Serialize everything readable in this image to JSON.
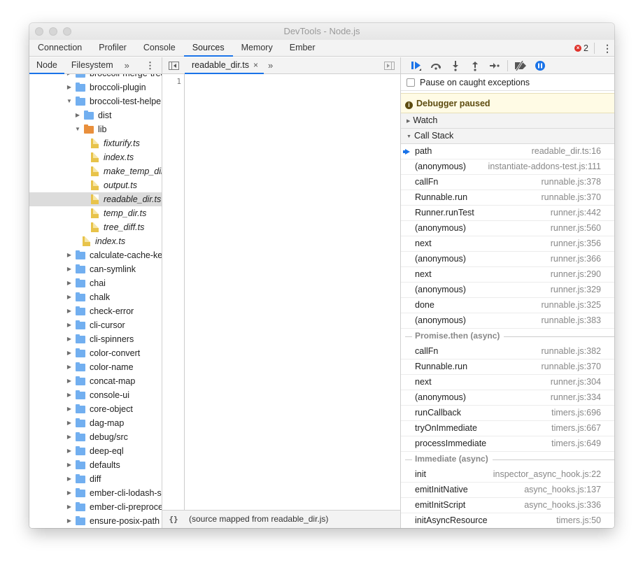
{
  "window": {
    "title": "DevTools - Node.js"
  },
  "main_tabs": [
    {
      "label": "Connection",
      "active": false
    },
    {
      "label": "Profiler",
      "active": false
    },
    {
      "label": "Console",
      "active": false
    },
    {
      "label": "Sources",
      "active": true
    },
    {
      "label": "Memory",
      "active": false
    },
    {
      "label": "Ember",
      "active": false
    }
  ],
  "errors": {
    "count": "2",
    "icon": "error-circle-icon"
  },
  "navigator": {
    "tabs": [
      {
        "label": "Node",
        "active": true
      },
      {
        "label": "Filesystem",
        "active": false
      }
    ],
    "more": "»",
    "tree": [
      {
        "label": "broccoli-merge-trees",
        "type": "folder",
        "depth": 0,
        "expanded": false
      },
      {
        "label": "broccoli-plugin",
        "type": "folder",
        "depth": 0,
        "expanded": false
      },
      {
        "label": "broccoli-test-helper",
        "type": "folder",
        "depth": 0,
        "expanded": true
      },
      {
        "label": "dist",
        "type": "folder",
        "depth": 1,
        "expanded": false
      },
      {
        "label": "lib",
        "type": "folder-orange",
        "depth": 1,
        "expanded": true
      },
      {
        "label": "fixturify.ts",
        "type": "file",
        "depth": 2
      },
      {
        "label": "index.ts",
        "type": "file",
        "depth": 2
      },
      {
        "label": "make_temp_dir.ts",
        "type": "file",
        "depth": 2
      },
      {
        "label": "output.ts",
        "type": "file",
        "depth": 2
      },
      {
        "label": "readable_dir.ts",
        "type": "file",
        "depth": 2,
        "selected": true
      },
      {
        "label": "temp_dir.ts",
        "type": "file",
        "depth": 2
      },
      {
        "label": "tree_diff.ts",
        "type": "file",
        "depth": 2
      },
      {
        "label": "index.ts",
        "type": "file",
        "depth": 1
      },
      {
        "label": "calculate-cache-key",
        "type": "folder",
        "depth": 0,
        "expanded": false
      },
      {
        "label": "can-symlink",
        "type": "folder",
        "depth": 0,
        "expanded": false
      },
      {
        "label": "chai",
        "type": "folder",
        "depth": 0,
        "expanded": false
      },
      {
        "label": "chalk",
        "type": "folder",
        "depth": 0,
        "expanded": false
      },
      {
        "label": "check-error",
        "type": "folder",
        "depth": 0,
        "expanded": false
      },
      {
        "label": "cli-cursor",
        "type": "folder",
        "depth": 0,
        "expanded": false
      },
      {
        "label": "cli-spinners",
        "type": "folder",
        "depth": 0,
        "expanded": false
      },
      {
        "label": "color-convert",
        "type": "folder",
        "depth": 0,
        "expanded": false
      },
      {
        "label": "color-name",
        "type": "folder",
        "depth": 0,
        "expanded": false
      },
      {
        "label": "concat-map",
        "type": "folder",
        "depth": 0,
        "expanded": false
      },
      {
        "label": "console-ui",
        "type": "folder",
        "depth": 0,
        "expanded": false
      },
      {
        "label": "core-object",
        "type": "folder",
        "depth": 0,
        "expanded": false
      },
      {
        "label": "dag-map",
        "type": "folder",
        "depth": 0,
        "expanded": false
      },
      {
        "label": "debug/src",
        "type": "folder",
        "depth": 0,
        "expanded": false
      },
      {
        "label": "deep-eql",
        "type": "folder",
        "depth": 0,
        "expanded": false
      },
      {
        "label": "defaults",
        "type": "folder",
        "depth": 0,
        "expanded": false
      },
      {
        "label": "diff",
        "type": "folder",
        "depth": 0,
        "expanded": false
      },
      {
        "label": "ember-cli-lodash-subset",
        "type": "folder",
        "depth": 0,
        "expanded": false
      },
      {
        "label": "ember-cli-preprocess-registry",
        "type": "folder",
        "depth": 0,
        "expanded": false
      },
      {
        "label": "ensure-posix-path",
        "type": "folder",
        "depth": 0,
        "expanded": false
      }
    ]
  },
  "editor": {
    "tabs": [
      {
        "label": "readable_dir.ts",
        "active": true
      }
    ],
    "more": "»",
    "line_numbers": [
      "1"
    ],
    "footer": {
      "format_icon": "{}",
      "message": "(source mapped from readable_dir.js)"
    }
  },
  "debugger": {
    "toolbar": [
      "resume-icon",
      "step-over-icon",
      "step-into-icon",
      "step-out-icon",
      "step-icon",
      "deactivate-breakpoints-icon",
      "pause-on-exceptions-icon"
    ],
    "pause_on_caught": {
      "label": "Pause on caught exceptions",
      "checked": false
    },
    "status": "Debugger paused",
    "watch_label": "Watch",
    "call_stack_label": "Call Stack",
    "call_stack": [
      {
        "kind": "frame",
        "fn": "path",
        "loc": "readable_dir.ts:16",
        "current": true
      },
      {
        "kind": "frame",
        "fn": "(anonymous)",
        "loc": "instantiate-addons-test.js:111"
      },
      {
        "kind": "frame",
        "fn": "callFn",
        "loc": "runnable.js:378"
      },
      {
        "kind": "frame",
        "fn": "Runnable.run",
        "loc": "runnable.js:370"
      },
      {
        "kind": "frame",
        "fn": "Runner.runTest",
        "loc": "runner.js:442"
      },
      {
        "kind": "frame",
        "fn": "(anonymous)",
        "loc": "runner.js:560"
      },
      {
        "kind": "frame",
        "fn": "next",
        "loc": "runner.js:356"
      },
      {
        "kind": "frame",
        "fn": "(anonymous)",
        "loc": "runner.js:366"
      },
      {
        "kind": "frame",
        "fn": "next",
        "loc": "runner.js:290"
      },
      {
        "kind": "frame",
        "fn": "(anonymous)",
        "loc": "runner.js:329"
      },
      {
        "kind": "frame",
        "fn": "done",
        "loc": "runnable.js:325"
      },
      {
        "kind": "frame",
        "fn": "(anonymous)",
        "loc": "runnable.js:383"
      },
      {
        "kind": "async",
        "label": "Promise.then (async)"
      },
      {
        "kind": "frame",
        "fn": "callFn",
        "loc": "runnable.js:382"
      },
      {
        "kind": "frame",
        "fn": "Runnable.run",
        "loc": "runnable.js:370"
      },
      {
        "kind": "frame",
        "fn": "next",
        "loc": "runner.js:304"
      },
      {
        "kind": "frame",
        "fn": "(anonymous)",
        "loc": "runner.js:334"
      },
      {
        "kind": "frame",
        "fn": "runCallback",
        "loc": "timers.js:696"
      },
      {
        "kind": "frame",
        "fn": "tryOnImmediate",
        "loc": "timers.js:667"
      },
      {
        "kind": "frame",
        "fn": "processImmediate",
        "loc": "timers.js:649"
      },
      {
        "kind": "async",
        "label": "Immediate (async)"
      },
      {
        "kind": "frame",
        "fn": "init",
        "loc": "inspector_async_hook.js:22"
      },
      {
        "kind": "frame",
        "fn": "emitInitNative",
        "loc": "async_hooks.js:137"
      },
      {
        "kind": "frame",
        "fn": "emitInitScript",
        "loc": "async_hooks.js:336"
      },
      {
        "kind": "frame",
        "fn": "initAsyncResource",
        "loc": "timers.js:50"
      }
    ]
  },
  "colors": {
    "accent": "#1a73e8",
    "error": "#e0322a",
    "folder": "#72aff0",
    "folder_highlight": "#e98f3c",
    "file": "#e8c34a",
    "paused_bg": "#fffbe5"
  }
}
